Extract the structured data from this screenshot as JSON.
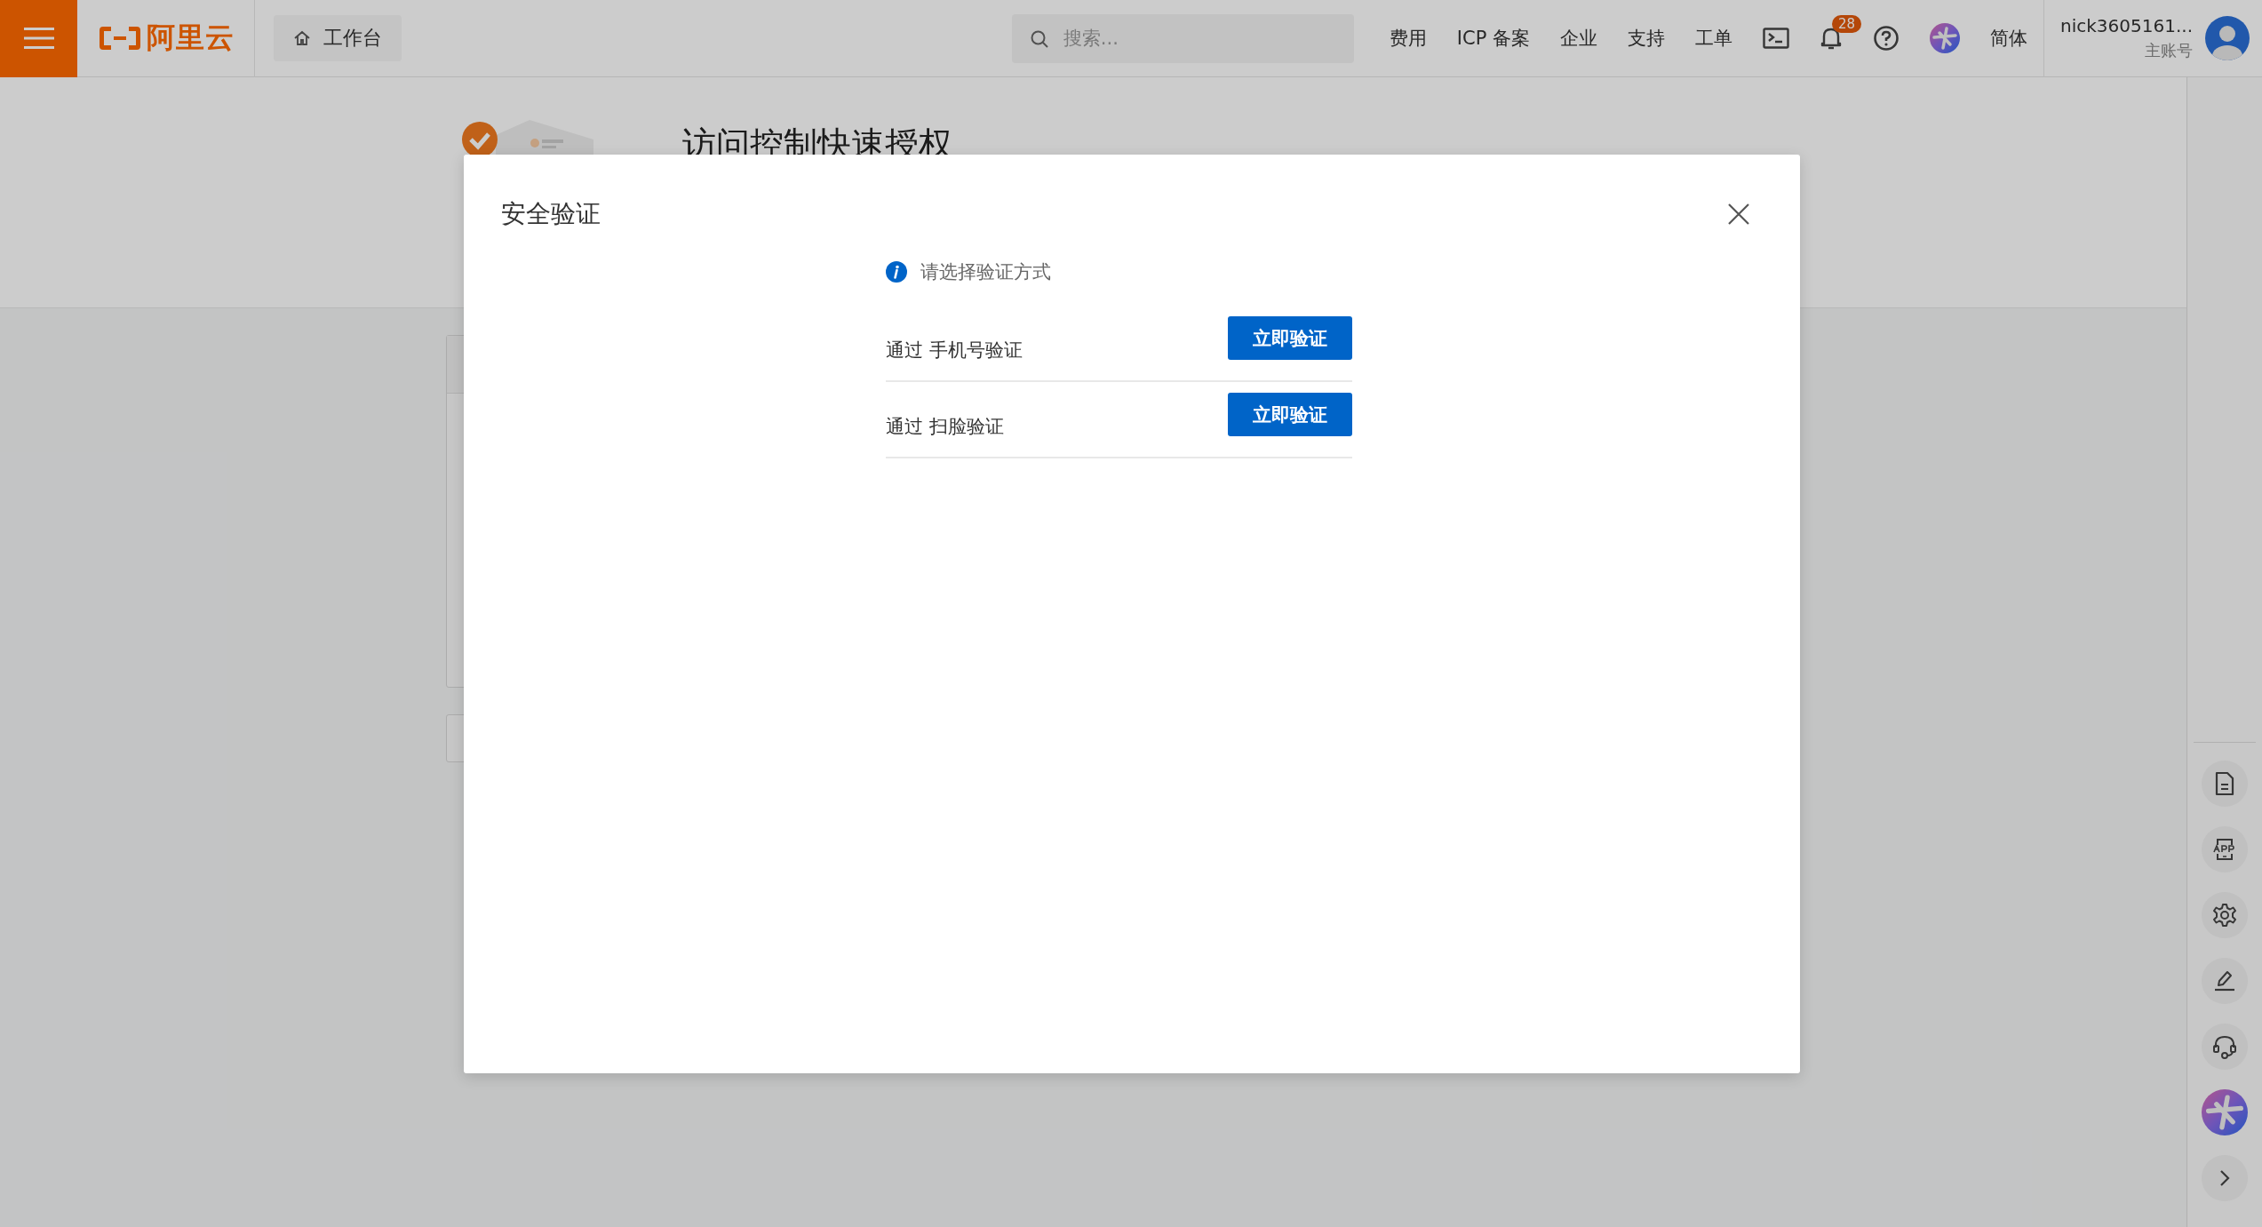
{
  "topbar": {
    "brand": "阿里云",
    "workbench": "工作台",
    "search": {
      "placeholder": "搜索..."
    },
    "nav": [
      "费用",
      "ICP 备案",
      "企业",
      "支持",
      "工单"
    ],
    "notification_count": "28",
    "language": "简体",
    "user": {
      "name": "nick3605161...",
      "role": "主账号"
    }
  },
  "page": {
    "title": "访问控制快速授权"
  },
  "dialog": {
    "title": "安全验证",
    "hint": "请选择验证方式",
    "options": [
      {
        "label": "通过 手机号验证",
        "action": "立即验证"
      },
      {
        "label": "通过 扫脸验证",
        "action": "立即验证"
      }
    ]
  }
}
